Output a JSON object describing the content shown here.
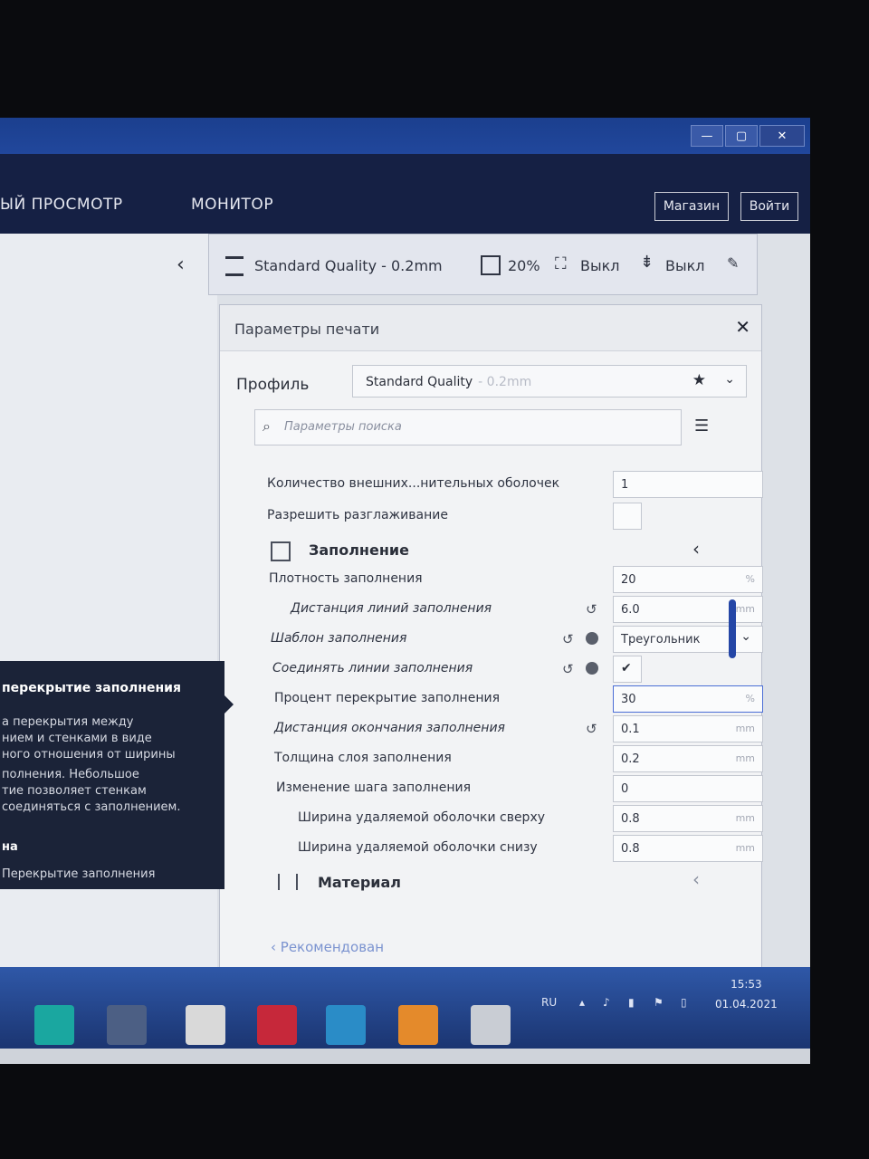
{
  "nav": {
    "preview": "ЫЙ ПРОСМОТР",
    "monitor": "МОНИТОР",
    "store": "Магазин",
    "login": "Войти"
  },
  "quickbar": {
    "profile": "Standard Quality - 0.2mm",
    "infill": "20%",
    "support": "Выкл",
    "adhesion": "Выкл"
  },
  "panel": {
    "title": "Параметры печати",
    "profile_label": "Профиль",
    "profile_name": "Standard Quality",
    "profile_layer": "- 0.2mm",
    "search_placeholder": "Параметры поиска"
  },
  "rows": {
    "outer_shells": {
      "label": "Количество внешних...нительных оболочек",
      "value": "1"
    },
    "ironing": {
      "label": "Разрешить разглаживание"
    },
    "infill_section": "Заполнение",
    "infill_density": {
      "label": "Плотность заполнения",
      "value": "20",
      "unit": "%"
    },
    "infill_line_distance": {
      "label": "Дистанция линий заполнения",
      "value": "6.0",
      "unit": "mm"
    },
    "infill_pattern": {
      "label": "Шаблон заполнения",
      "value": "Треугольник"
    },
    "connect_infill_lines": {
      "label": "Соединять линии заполнения",
      "value": "✔"
    },
    "infill_overlap_percent": {
      "label": "Процент перекрытие заполнения",
      "value": "30",
      "unit": "%"
    },
    "infill_wipe_distance": {
      "label": "Дистанция окончания заполнения",
      "value": "0.1",
      "unit": "mm"
    },
    "infill_layer_thickness": {
      "label": "Толщина слоя заполнения",
      "value": "0.2",
      "unit": "mm"
    },
    "gradual_infill_steps": {
      "label": "Изменение шага заполнения",
      "value": "0"
    },
    "skin_removal_top": {
      "label": "Ширина удаляемой оболочки сверху",
      "value": "0.8",
      "unit": "mm"
    },
    "skin_removal_bottom": {
      "label": "Ширина удаляемой оболочки снизу",
      "value": "0.8",
      "unit": "mm"
    },
    "material_section": "Материал"
  },
  "recommended": "Рекомендован",
  "tooltip": {
    "title": "перекрытие заполнения",
    "lines": [
      "а перекрытия между",
      "нием и стенками в виде",
      "ного отношения от ширины",
      "полнения. Небольшое",
      "тие позволяет стенкам",
      " соединяться с заполнением.",
      "на",
      "Перекрытие заполнения"
    ]
  },
  "tray": {
    "lang": "RU",
    "time": "15:53",
    "date": "01.04.2021"
  }
}
